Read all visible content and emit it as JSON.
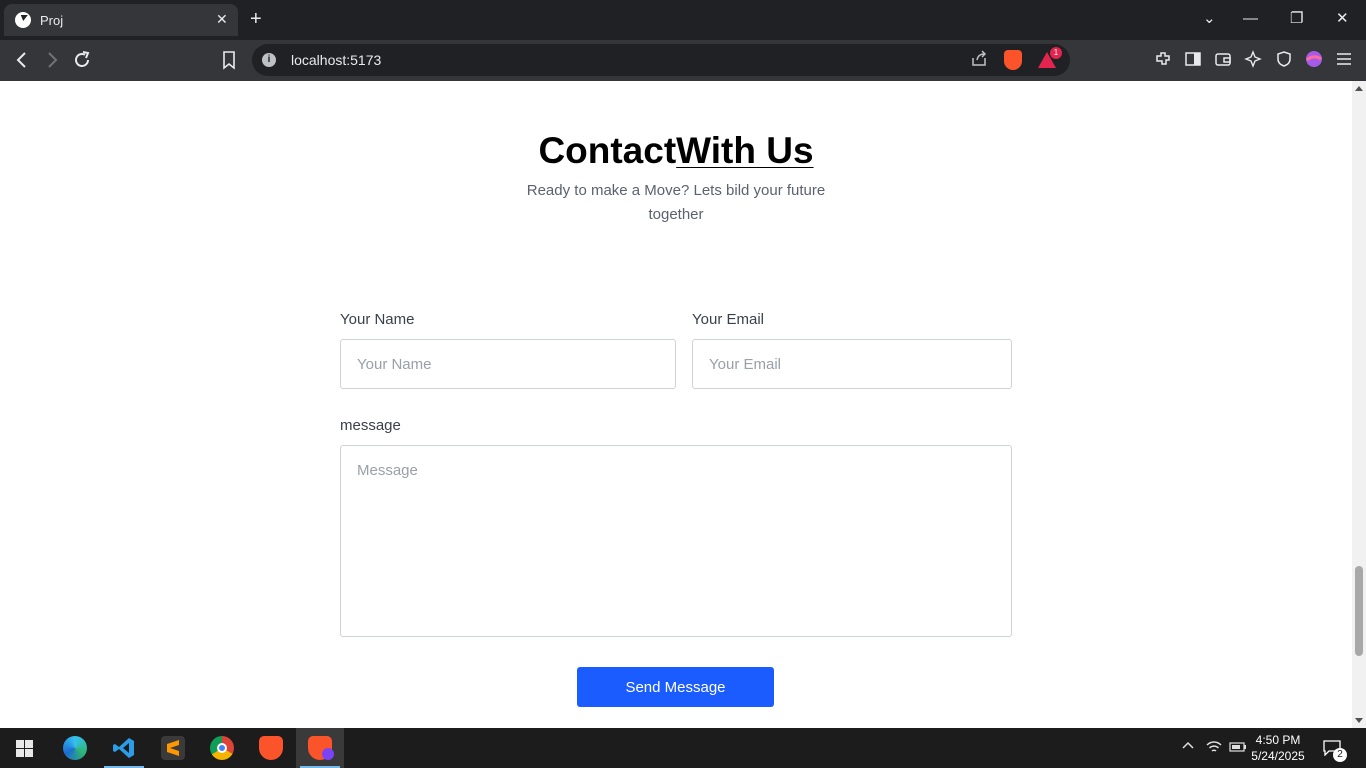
{
  "browser": {
    "tab_title": "Proj",
    "tab_close_glyph": "✕",
    "new_tab_glyph": "+",
    "url": "localhost:5173",
    "rewards_badge": "1",
    "window_controls": {
      "dropdown": "⌄",
      "minimize": "—",
      "restore": "❐",
      "close": "✕"
    },
    "icons": [
      "back-icon",
      "forward-icon",
      "reload-icon",
      "bookmark-icon",
      "site-info-icon",
      "share-icon",
      "brave-shields-icon",
      "brave-rewards-icon",
      "extensions-icon",
      "sidebar-icon",
      "wallet-icon",
      "leo-ai-icon",
      "vpn-icon",
      "profile-icon",
      "menu-icon"
    ]
  },
  "page": {
    "heading_bold": "Contact",
    "heading_light": "With Us",
    "subtitle": "Ready to make a Move? Lets bild your future together",
    "form": {
      "name_label": "Your Name",
      "name_placeholder": "Your Name",
      "name_value": "",
      "email_label": "Your Email",
      "email_placeholder": "Your Email",
      "email_value": "",
      "message_label": "message",
      "message_placeholder": "Message",
      "message_value": "",
      "submit_label": "Send Message"
    }
  },
  "taskbar": {
    "apps": [
      "edge",
      "vscode",
      "sublime-text",
      "chrome",
      "brave",
      "brave-nightly"
    ],
    "active_app": "brave-nightly",
    "time": "4:50 PM",
    "date": "5/24/2025",
    "notification_count": "2"
  },
  "colors": {
    "accent": "#1a5cff",
    "chrome_dark": "#202124",
    "chrome_toolbar": "#35363a",
    "taskbar": "#1c1c1c"
  }
}
